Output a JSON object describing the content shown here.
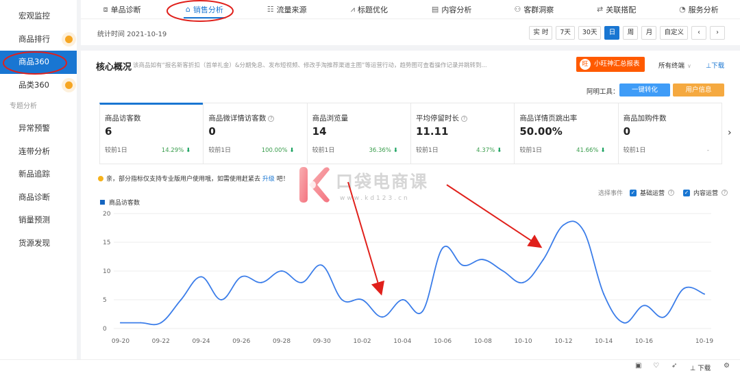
{
  "sidebar": {
    "items": [
      {
        "label": "宏观监控"
      },
      {
        "label": "商品排行",
        "dot": true
      },
      {
        "label": "商品360",
        "active": true
      },
      {
        "label": "品类360",
        "dot": true
      }
    ],
    "group_label": "专题分析",
    "group_items": [
      "异常预警",
      "连带分析",
      "新品追踪",
      "商品诊断",
      "销量预测",
      "货源发现"
    ]
  },
  "tabs": [
    {
      "label": "单品诊断",
      "icon": "box-icon"
    },
    {
      "label": "销售分析",
      "icon": "bag-icon",
      "active": true
    },
    {
      "label": "流量来源",
      "icon": "flow-icon"
    },
    {
      "label": "标题优化",
      "icon": "chart-icon"
    },
    {
      "label": "内容分析",
      "icon": "content-icon"
    },
    {
      "label": "客群洞察",
      "icon": "people-icon"
    },
    {
      "label": "关联搭配",
      "icon": "link-icon"
    },
    {
      "label": "服务分析",
      "icon": "headset-icon"
    }
  ],
  "date_bar": {
    "stat_time": "统计时间 2021-10-19",
    "buttons": [
      "实 时",
      "7天",
      "30天",
      "日",
      "周",
      "月",
      "自定义"
    ],
    "active_button": "日",
    "prev": "‹",
    "next": "›"
  },
  "core": {
    "title": "核心概况",
    "desc": "该商品如有“报名新客折扣（首单礼金）&分期免息、发布短视频、修改手淘推荐渠道主图”等运营行动，趋势图可查看操作记录并跳转到...",
    "wang_button": "小旺神汇总报表",
    "terminal": "所有终端",
    "download": "⊥下载",
    "tools_label": "阿明工具：",
    "tool_blue": "一键转化",
    "tool_orange": "用户信息"
  },
  "metrics": [
    {
      "label": "商品访客数",
      "value": "6",
      "cmp": "较前1日",
      "pct": "14.29%",
      "arrow": "down",
      "help": false
    },
    {
      "label": "商品微详情访客数",
      "value": "0",
      "cmp": "较前1日",
      "pct": "100.00%",
      "arrow": "down",
      "help": true
    },
    {
      "label": "商品浏览量",
      "value": "14",
      "cmp": "较前1日",
      "pct": "36.36%",
      "arrow": "down",
      "help": false
    },
    {
      "label": "平均停留时长",
      "value": "11.11",
      "cmp": "较前1日",
      "pct": "4.37%",
      "arrow": "down",
      "help": true
    },
    {
      "label": "商品详情页跳出率",
      "value": "50.00%",
      "cmp": "较前1日",
      "pct": "41.66%",
      "arrow": "down",
      "help": false
    },
    {
      "label": "商品加购件数",
      "value": "0",
      "cmp": "较前1日",
      "pct": "-",
      "arrow": "none",
      "help": false
    }
  ],
  "notice": {
    "text": "亲，部分指标仅支持专业版用户使用哦，如需使用赶紧去",
    "link": "升级",
    "suffix": "吧！"
  },
  "watermark": {
    "text": "口袋电商课",
    "url": "www.kd123.cn"
  },
  "events": {
    "label": "选择事件",
    "options": [
      {
        "label": "基础运营",
        "checked": true
      },
      {
        "label": "内容运营",
        "checked": true
      }
    ]
  },
  "bottom": {
    "download": "⊥ 下载"
  },
  "colors": {
    "accent": "#1976d2",
    "line": "#3b7de9",
    "annotation": "#e0201b",
    "down_arrow": "#1aa260"
  },
  "chart_data": {
    "type": "line",
    "legend": "商品访客数",
    "ylim": [
      0,
      20
    ],
    "yticks": [
      0,
      5,
      10,
      15,
      20
    ],
    "x": [
      "09-20",
      "09-21",
      "09-22",
      "09-23",
      "09-24",
      "09-25",
      "09-26",
      "09-27",
      "09-28",
      "09-29",
      "09-30",
      "10-01",
      "10-02",
      "10-03",
      "10-04",
      "10-05",
      "10-06",
      "10-07",
      "10-08",
      "10-09",
      "10-10",
      "10-11",
      "10-12",
      "10-13",
      "10-14",
      "10-15",
      "10-16",
      "10-17",
      "10-18",
      "10-19"
    ],
    "xtick_labels": [
      "09-20",
      "09-22",
      "09-24",
      "09-26",
      "09-28",
      "09-30",
      "10-02",
      "10-04",
      "10-06",
      "10-08",
      "10-10",
      "10-12",
      "10-14",
      "10-16",
      "10-19"
    ],
    "series": [
      {
        "name": "商品访客数",
        "values": [
          1,
          1,
          1,
          5,
          9,
          5,
          9,
          8,
          10,
          8,
          11,
          5,
          5,
          2,
          5,
          3,
          14,
          11,
          12,
          10,
          8,
          12,
          18,
          17,
          6,
          1,
          4,
          2,
          7,
          6
        ]
      }
    ]
  }
}
